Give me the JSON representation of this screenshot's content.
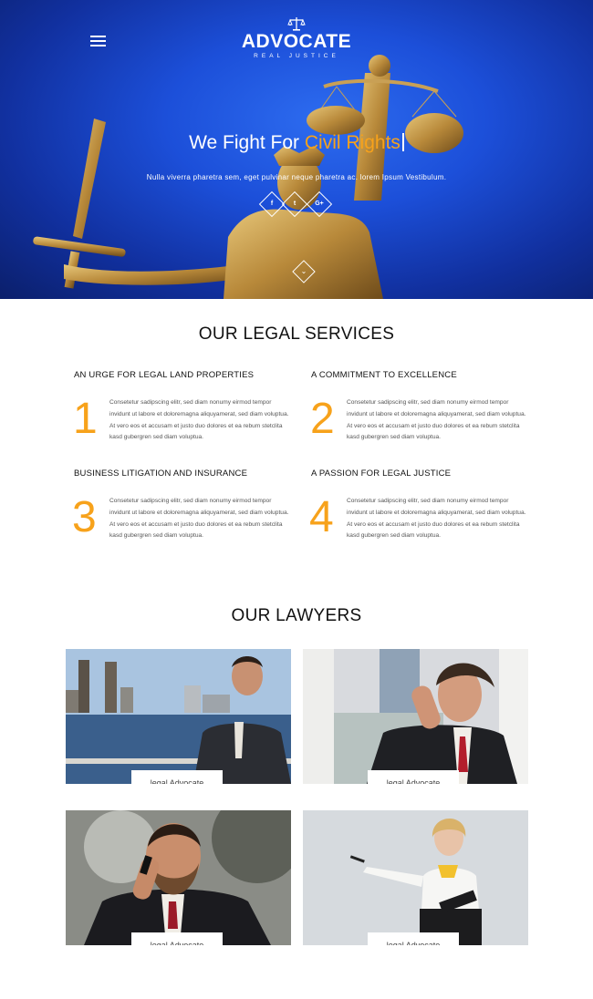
{
  "header": {
    "logo_title": "ADVOCATE",
    "logo_tagline": "REAL JUSTICE"
  },
  "hero": {
    "title_part1": "We Fight For ",
    "title_accent": "Civil Rights",
    "subtitle": "Nulla viverra pharetra sem, eget pulvinar neque pharetra ac. lorem Ipsum Vestibulum.",
    "social": [
      "f",
      "t",
      "G+"
    ],
    "accent_color": "#f7a21b"
  },
  "services": {
    "title": "OUR LEGAL SERVICES",
    "items": [
      {
        "number": "1",
        "heading": "AN URGE FOR LEGAL LAND PROPERTIES",
        "text": "Consetetur sadipscing elitr, sed diam nonumy eirmod tempor invidunt ut labore et doloremagna aliquyamerat, sed diam voluptua. At vero eos et accusam et justo duo dolores et ea rebum stetclita kasd gubergren sed diam voluptua."
      },
      {
        "number": "2",
        "heading": "A COMMITMENT TO EXCELLENCE",
        "text": "Consetetur sadipscing elitr, sed diam nonumy eirmod tempor invidunt ut labore et doloremagna aliquyamerat, sed diam voluptua. At vero eos et accusam et justo duo dolores et ea rebum stetclita kasd gubergren sed diam voluptua."
      },
      {
        "number": "3",
        "heading": "BUSINESS LITIGATION AND INSURANCE",
        "text": "Consetetur sadipscing elitr, sed diam nonumy eirmod tempor invidunt ut labore et doloremagna aliquyamerat, sed diam voluptua. At vero eos et accusam et justo duo dolores et ea rebum stetclita kasd gubergren sed diam voluptua."
      },
      {
        "number": "4",
        "heading": "A PASSION FOR LEGAL JUSTICE",
        "text": "Consetetur sadipscing elitr, sed diam nonumy eirmod tempor invidunt ut labore et doloremagna aliquyamerat, sed diam voluptua. At vero eos et accusam et justo duo dolores et ea rebum stetclita kasd gubergren sed diam voluptua."
      }
    ]
  },
  "lawyers": {
    "title": "OUR LAWYERS",
    "items": [
      {
        "label": "legal Advocate"
      },
      {
        "label": "legal Advocate"
      },
      {
        "label": "legal Advocate"
      },
      {
        "label": "legal Advocate"
      }
    ]
  }
}
